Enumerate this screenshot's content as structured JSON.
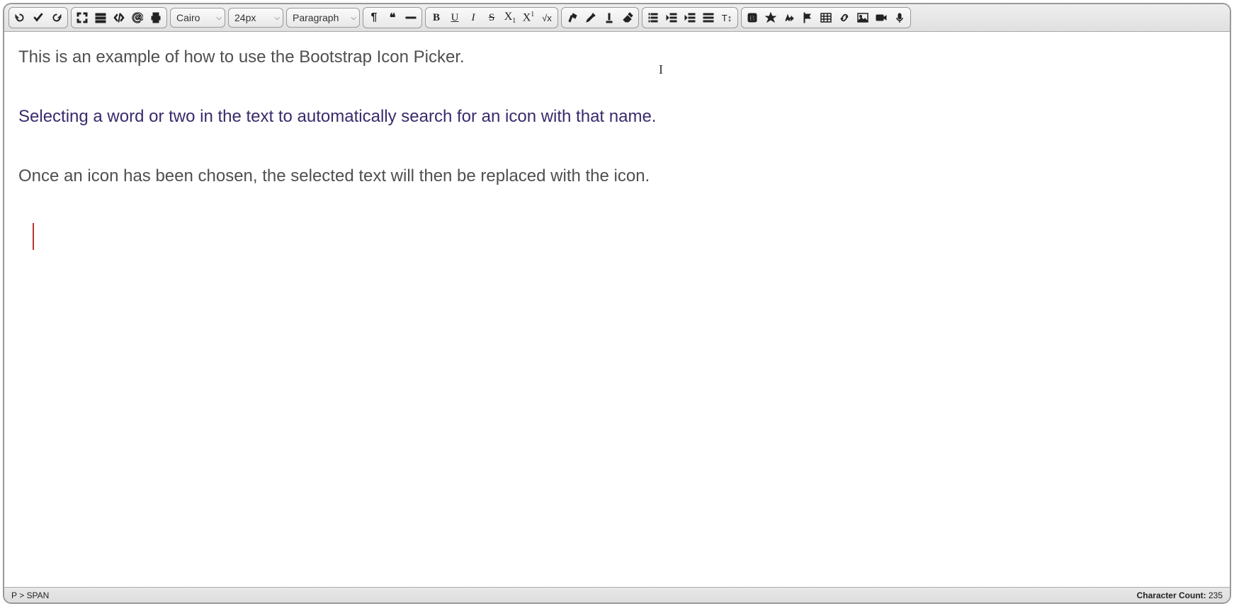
{
  "toolbar": {
    "undo": "Undo",
    "save": "Save",
    "redo": "Redo",
    "fullscreen": "Fullscreen",
    "blocks": "Blocks",
    "code": "Code View",
    "mention": "Mention",
    "print": "Print",
    "font_family": "Cairo",
    "font_size": "24px",
    "format": "Paragraph",
    "paragraph": "Paragraph marks",
    "quote": "Blockquote",
    "hr": "Horizontal rule",
    "bold": "Bold",
    "underline": "Underline",
    "italic": "Italic",
    "strike": "Strikethrough",
    "sub": "Subscript",
    "sup": "Superscript",
    "math": "Math",
    "clean": "Clean formatting",
    "marker": "Highlight",
    "textcolor": "Text color",
    "eraser": "Remove format",
    "ol": "Ordered list",
    "outdent": "Outdent",
    "indent": "Indent",
    "ul": "Unordered list",
    "lineheight": "Line height",
    "iconpicker": "Icon picker",
    "star": "Special char",
    "casechange": "Change case",
    "flag": "Flag",
    "table": "Table",
    "link": "Link",
    "image": "Image",
    "video": "Video",
    "audio": "Audio"
  },
  "content": {
    "line1": "This is an example of how to use the Bootstrap Icon Picker.",
    "line2": "Selecting a word or two in the text to automatically search for an icon with that name.",
    "line3": "Once an icon has been chosen, the selected text will then be replaced with the icon."
  },
  "statusbar": {
    "path": "P > SPAN",
    "count_label": "Character Count: ",
    "count": "235"
  }
}
